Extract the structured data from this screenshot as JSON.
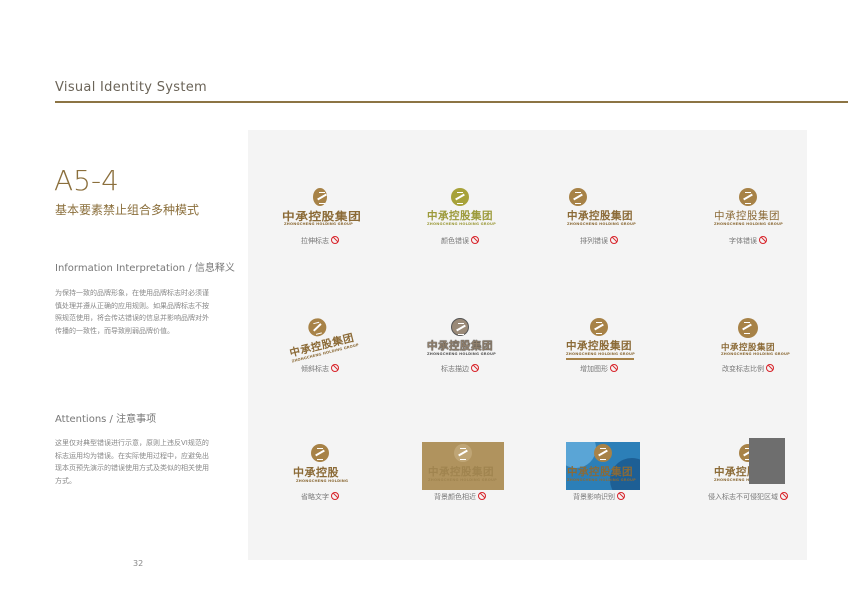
{
  "header": {
    "title": "Visual Identity System"
  },
  "section": {
    "code": "A5-4",
    "subtitle": "基本要素禁止组合多种模式"
  },
  "info": {
    "heading": "Information Interpretation / 信息释义",
    "lines": [
      "为保持一致的品牌形象，在使用品牌标志时必须谨",
      "慎处理并遵从正确的应用规则。如果品牌标志不按",
      "照规范使用，将会传达错误的信息并影响品牌对外",
      "传播的一致性，而导致削弱品牌价值。"
    ]
  },
  "attentions": {
    "heading": "Attentions / 注意事项",
    "lines": [
      "这里仅对典型错误进行示意，原则上违反VI规范的",
      "标志运用均为错误。在实际使用过程中，应避免出",
      "现本页预先演示的错误使用方式及类似的相关使用",
      "方式。"
    ]
  },
  "logo": {
    "name_cn": "中承控股集团",
    "name_en": "ZHONGCHENG HOLDING GROUP",
    "short_cn": "中承控股",
    "short_en": "ZHONGCHENG HOLDING"
  },
  "examples": [
    {
      "caption": "拉伸标志"
    },
    {
      "caption": "颜色错误"
    },
    {
      "caption": "排列错误"
    },
    {
      "caption": "字体错误"
    },
    {
      "caption": "倾斜标志"
    },
    {
      "caption": "标志描边"
    },
    {
      "caption": "增加图形"
    },
    {
      "caption": "改变标志比例"
    },
    {
      "caption": "省略文字"
    },
    {
      "caption": "背景颜色相近"
    },
    {
      "caption": "背景影响识别"
    },
    {
      "caption": "侵入标志不可侵犯区域"
    }
  ],
  "colors": {
    "gold": "#8b6a36",
    "emblem": "#a78247",
    "prohibit": "#d8232a",
    "rule": "#8c7444"
  },
  "page": {
    "number": "32"
  }
}
